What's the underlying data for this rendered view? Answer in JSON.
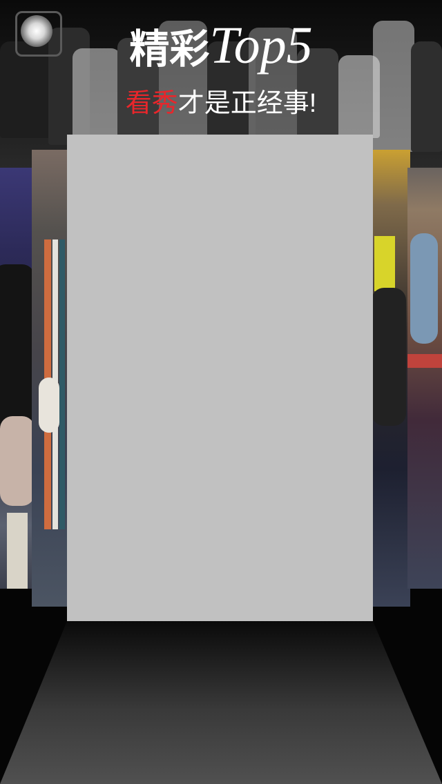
{
  "header": {
    "title_cn": "精彩",
    "title_en": "Top5",
    "subtitle_highlight": "看秀",
    "subtitle_rest": "才是正经事!"
  },
  "colors": {
    "background": "#050505",
    "highlight_red": "#e8262b",
    "main_card": "#c1c1c1",
    "runway_top": "#0a0a0a",
    "runway_bottom": "#505050"
  },
  "icons": {
    "spotlight": "spotlight-icon"
  },
  "carousel": {
    "cards": [
      "left-back",
      "left-mid",
      "main",
      "right-mid",
      "right-back"
    ],
    "active_card": "main"
  }
}
